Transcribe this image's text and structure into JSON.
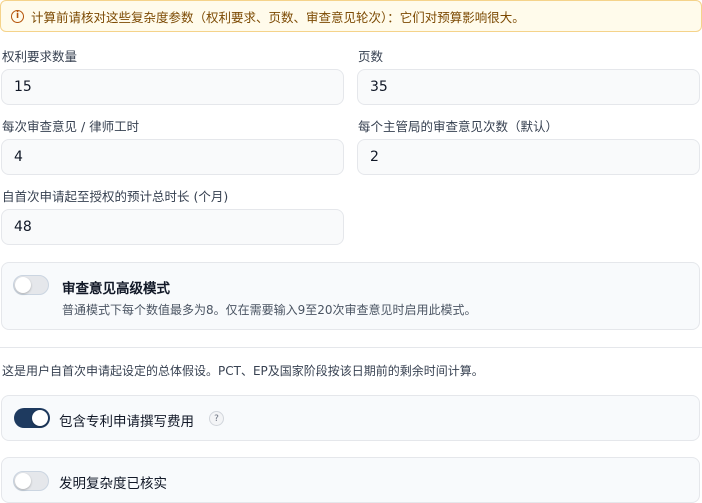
{
  "notice": {
    "icon": "info-circle-icon",
    "text": "计算前请核对这些复杂度参数（权利要求、页数、审查意见轮次）：它们对预算影响很大。"
  },
  "fields": {
    "claims": {
      "label": "权利要求数量",
      "value": "15"
    },
    "pages": {
      "label": "页数",
      "value": "35"
    },
    "hours_per_oa": {
      "label": "每次审查意见 / 律师工时",
      "value": "4"
    },
    "oa_per_office": {
      "label": "每个主管局的审查意见次数（默认）",
      "value": "2"
    },
    "total_duration": {
      "label": "自首次申请起至授权的预计总时长 (个月)",
      "value": "48"
    }
  },
  "advanced_mode": {
    "enabled": false,
    "title": "审查意见高级模式",
    "description": "普通模式下每个数值最多为8。仅在需要输入9至20次审查意见时启用此模式。"
  },
  "assumption_note": "这是用户自首次申请起设定的总体假设。PCT、EP及国家阶段按该日期前的剩余时间计算。",
  "include_drafting": {
    "enabled": true,
    "label": "包含专利申请撰写费用",
    "help": "?"
  },
  "complexity_verified": {
    "enabled": false,
    "label": "发明复杂度已核实"
  },
  "colors": {
    "toggle_on": "#1e3a5f",
    "notice_bg": "#fffbeb"
  }
}
